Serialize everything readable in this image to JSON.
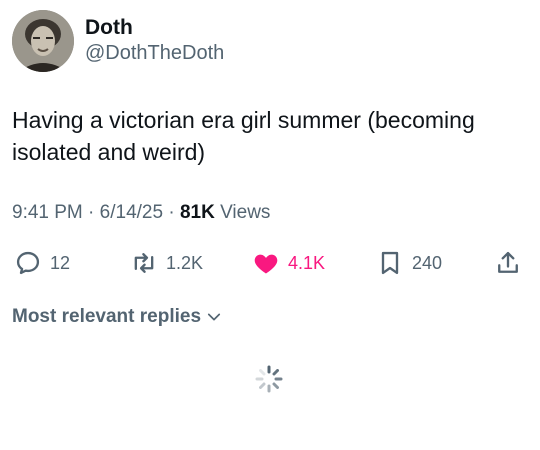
{
  "author": {
    "display_name": "Doth",
    "handle": "@DothTheDoth",
    "avatar_icon": "avatar-portrait"
  },
  "tweet": {
    "text": "Having a victorian era girl summer (becoming isolated and weird)",
    "time": "9:41 PM",
    "date": "6/14/25",
    "views_count": "81K",
    "views_label": "Views"
  },
  "actions": {
    "replies": "12",
    "retweets": "1.2K",
    "likes": "4.1K",
    "bookmarks": "240"
  },
  "replies_sort": {
    "label": "Most relevant replies"
  },
  "colors": {
    "like_accent": "#f91880",
    "muted": "#536471",
    "text": "#0f1419"
  }
}
